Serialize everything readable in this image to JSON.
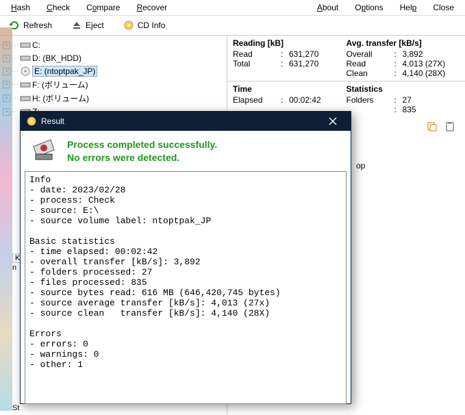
{
  "menu": {
    "hash": "Hash",
    "check": "Check",
    "compare": "Compare",
    "recover": "Recover",
    "about": "About",
    "options": "Options",
    "help": "Help",
    "close": "Close"
  },
  "toolbar": {
    "refresh": "Refresh",
    "eject": "Eject",
    "cdinfo": "CD Info"
  },
  "drives": {
    "c": "C:",
    "d": "D: (BK_HDD)",
    "e": "E: (ntoptpak_JP)",
    "f": "F: (ボリューム)",
    "h": "H: (ボリューム)",
    "z": "Z:"
  },
  "stats1": {
    "left_hdr": "Reading [kB]",
    "read_k": "Read",
    "read_v": "631,270",
    "total_k": "Total",
    "total_v": "631,270",
    "right_hdr": "Avg. transfer [kB/s]",
    "overall_k": "Overall",
    "overall_v": "3,892",
    "aread_k": "Read",
    "aread_v": "4,013 (27X)",
    "clean_k": "Clean",
    "clean_v": "4,140 (28X)"
  },
  "stats2": {
    "left_hdr": "Time",
    "elapsed_k": "Elapsed",
    "elapsed_v": "00:02:42",
    "right_hdr": "Statistics",
    "folders_k": "Folders",
    "folders_v": "27",
    "files_v": "835"
  },
  "op_text": "op",
  "dialog": {
    "title": "Result",
    "msg_l1": "Process completed successfully.",
    "msg_l2": "No errors were detected.",
    "log": "Info\n- date: 2023/02/28\n- process: Check\n- source: E:\\\n- source volume label: ntoptpak_JP\n\nBasic statistics\n- time elapsed: 00:02:42\n- overall transfer [kB/s]: 3,892\n- folders processed: 27\n- files processed: 835\n- source bytes read: 616 MB (646,420,745 bytes)\n- source average transfer [kB/s]: 4,013 (27x)\n- source clean   transfer [kB/s]: 4,140 (28X)\n\nErrors\n- errors: 0\n- warnings: 0\n- other: 1"
  },
  "misc": {
    "K": "K",
    "n": "n",
    "St": "St"
  }
}
